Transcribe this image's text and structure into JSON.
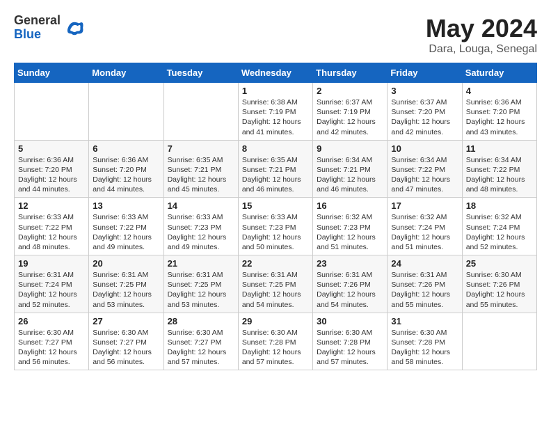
{
  "logo": {
    "general": "General",
    "blue": "Blue"
  },
  "header": {
    "month": "May 2024",
    "location": "Dara, Louga, Senegal"
  },
  "weekdays": [
    "Sunday",
    "Monday",
    "Tuesday",
    "Wednesday",
    "Thursday",
    "Friday",
    "Saturday"
  ],
  "weeks": [
    [
      {
        "day": "",
        "info": ""
      },
      {
        "day": "",
        "info": ""
      },
      {
        "day": "",
        "info": ""
      },
      {
        "day": "1",
        "info": "Sunrise: 6:38 AM\nSunset: 7:19 PM\nDaylight: 12 hours\nand 41 minutes."
      },
      {
        "day": "2",
        "info": "Sunrise: 6:37 AM\nSunset: 7:19 PM\nDaylight: 12 hours\nand 42 minutes."
      },
      {
        "day": "3",
        "info": "Sunrise: 6:37 AM\nSunset: 7:20 PM\nDaylight: 12 hours\nand 42 minutes."
      },
      {
        "day": "4",
        "info": "Sunrise: 6:36 AM\nSunset: 7:20 PM\nDaylight: 12 hours\nand 43 minutes."
      }
    ],
    [
      {
        "day": "5",
        "info": "Sunrise: 6:36 AM\nSunset: 7:20 PM\nDaylight: 12 hours\nand 44 minutes."
      },
      {
        "day": "6",
        "info": "Sunrise: 6:36 AM\nSunset: 7:20 PM\nDaylight: 12 hours\nand 44 minutes."
      },
      {
        "day": "7",
        "info": "Sunrise: 6:35 AM\nSunset: 7:21 PM\nDaylight: 12 hours\nand 45 minutes."
      },
      {
        "day": "8",
        "info": "Sunrise: 6:35 AM\nSunset: 7:21 PM\nDaylight: 12 hours\nand 46 minutes."
      },
      {
        "day": "9",
        "info": "Sunrise: 6:34 AM\nSunset: 7:21 PM\nDaylight: 12 hours\nand 46 minutes."
      },
      {
        "day": "10",
        "info": "Sunrise: 6:34 AM\nSunset: 7:22 PM\nDaylight: 12 hours\nand 47 minutes."
      },
      {
        "day": "11",
        "info": "Sunrise: 6:34 AM\nSunset: 7:22 PM\nDaylight: 12 hours\nand 48 minutes."
      }
    ],
    [
      {
        "day": "12",
        "info": "Sunrise: 6:33 AM\nSunset: 7:22 PM\nDaylight: 12 hours\nand 48 minutes."
      },
      {
        "day": "13",
        "info": "Sunrise: 6:33 AM\nSunset: 7:22 PM\nDaylight: 12 hours\nand 49 minutes."
      },
      {
        "day": "14",
        "info": "Sunrise: 6:33 AM\nSunset: 7:23 PM\nDaylight: 12 hours\nand 49 minutes."
      },
      {
        "day": "15",
        "info": "Sunrise: 6:33 AM\nSunset: 7:23 PM\nDaylight: 12 hours\nand 50 minutes."
      },
      {
        "day": "16",
        "info": "Sunrise: 6:32 AM\nSunset: 7:23 PM\nDaylight: 12 hours\nand 51 minutes."
      },
      {
        "day": "17",
        "info": "Sunrise: 6:32 AM\nSunset: 7:24 PM\nDaylight: 12 hours\nand 51 minutes."
      },
      {
        "day": "18",
        "info": "Sunrise: 6:32 AM\nSunset: 7:24 PM\nDaylight: 12 hours\nand 52 minutes."
      }
    ],
    [
      {
        "day": "19",
        "info": "Sunrise: 6:31 AM\nSunset: 7:24 PM\nDaylight: 12 hours\nand 52 minutes."
      },
      {
        "day": "20",
        "info": "Sunrise: 6:31 AM\nSunset: 7:25 PM\nDaylight: 12 hours\nand 53 minutes."
      },
      {
        "day": "21",
        "info": "Sunrise: 6:31 AM\nSunset: 7:25 PM\nDaylight: 12 hours\nand 53 minutes."
      },
      {
        "day": "22",
        "info": "Sunrise: 6:31 AM\nSunset: 7:25 PM\nDaylight: 12 hours\nand 54 minutes."
      },
      {
        "day": "23",
        "info": "Sunrise: 6:31 AM\nSunset: 7:26 PM\nDaylight: 12 hours\nand 54 minutes."
      },
      {
        "day": "24",
        "info": "Sunrise: 6:31 AM\nSunset: 7:26 PM\nDaylight: 12 hours\nand 55 minutes."
      },
      {
        "day": "25",
        "info": "Sunrise: 6:30 AM\nSunset: 7:26 PM\nDaylight: 12 hours\nand 55 minutes."
      }
    ],
    [
      {
        "day": "26",
        "info": "Sunrise: 6:30 AM\nSunset: 7:27 PM\nDaylight: 12 hours\nand 56 minutes."
      },
      {
        "day": "27",
        "info": "Sunrise: 6:30 AM\nSunset: 7:27 PM\nDaylight: 12 hours\nand 56 minutes."
      },
      {
        "day": "28",
        "info": "Sunrise: 6:30 AM\nSunset: 7:27 PM\nDaylight: 12 hours\nand 57 minutes."
      },
      {
        "day": "29",
        "info": "Sunrise: 6:30 AM\nSunset: 7:28 PM\nDaylight: 12 hours\nand 57 minutes."
      },
      {
        "day": "30",
        "info": "Sunrise: 6:30 AM\nSunset: 7:28 PM\nDaylight: 12 hours\nand 57 minutes."
      },
      {
        "day": "31",
        "info": "Sunrise: 6:30 AM\nSunset: 7:28 PM\nDaylight: 12 hours\nand 58 minutes."
      },
      {
        "day": "",
        "info": ""
      }
    ]
  ]
}
